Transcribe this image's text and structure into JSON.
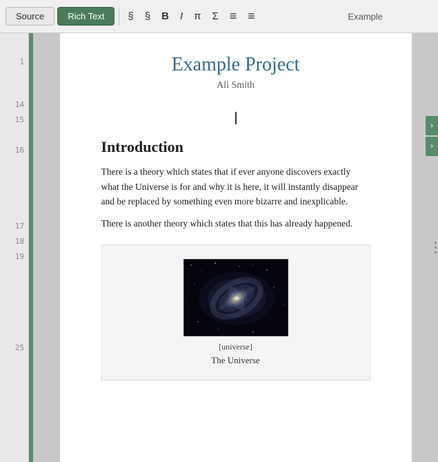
{
  "toolbar": {
    "title": "Example",
    "source_tab": "Source",
    "richtext_tab": "Rich Text",
    "btn_s1": "§",
    "btn_s2": "§",
    "btn_bold": "B",
    "btn_italic": "I",
    "btn_pi": "π",
    "btn_sigma": "Σ",
    "btn_list1": "≡",
    "btn_list2": "≡"
  },
  "document": {
    "title": "Example Project",
    "author": "Ali Smith",
    "section_heading": "Introduction",
    "paragraph1": "There is a theory which states that if ever anyone discovers exactly what the Universe is for and why it is here, it will instantly disappear and be replaced by something even more bizarre and inexplicable.",
    "paragraph2": "There is another theory which states that this has already happened.",
    "image_tag": "[universe]",
    "image_caption": "The Universe"
  },
  "line_numbers": [
    "",
    "1",
    "",
    "",
    "",
    "",
    "",
    "14",
    "15",
    "",
    "16",
    "",
    "",
    "",
    "",
    "",
    "17",
    "18",
    "19",
    "",
    "",
    "",
    "",
    "",
    "",
    "25"
  ],
  "colors": {
    "accent": "#5a8a6a",
    "tab_active": "#4a7c59",
    "title_color": "#3a6a8a"
  }
}
